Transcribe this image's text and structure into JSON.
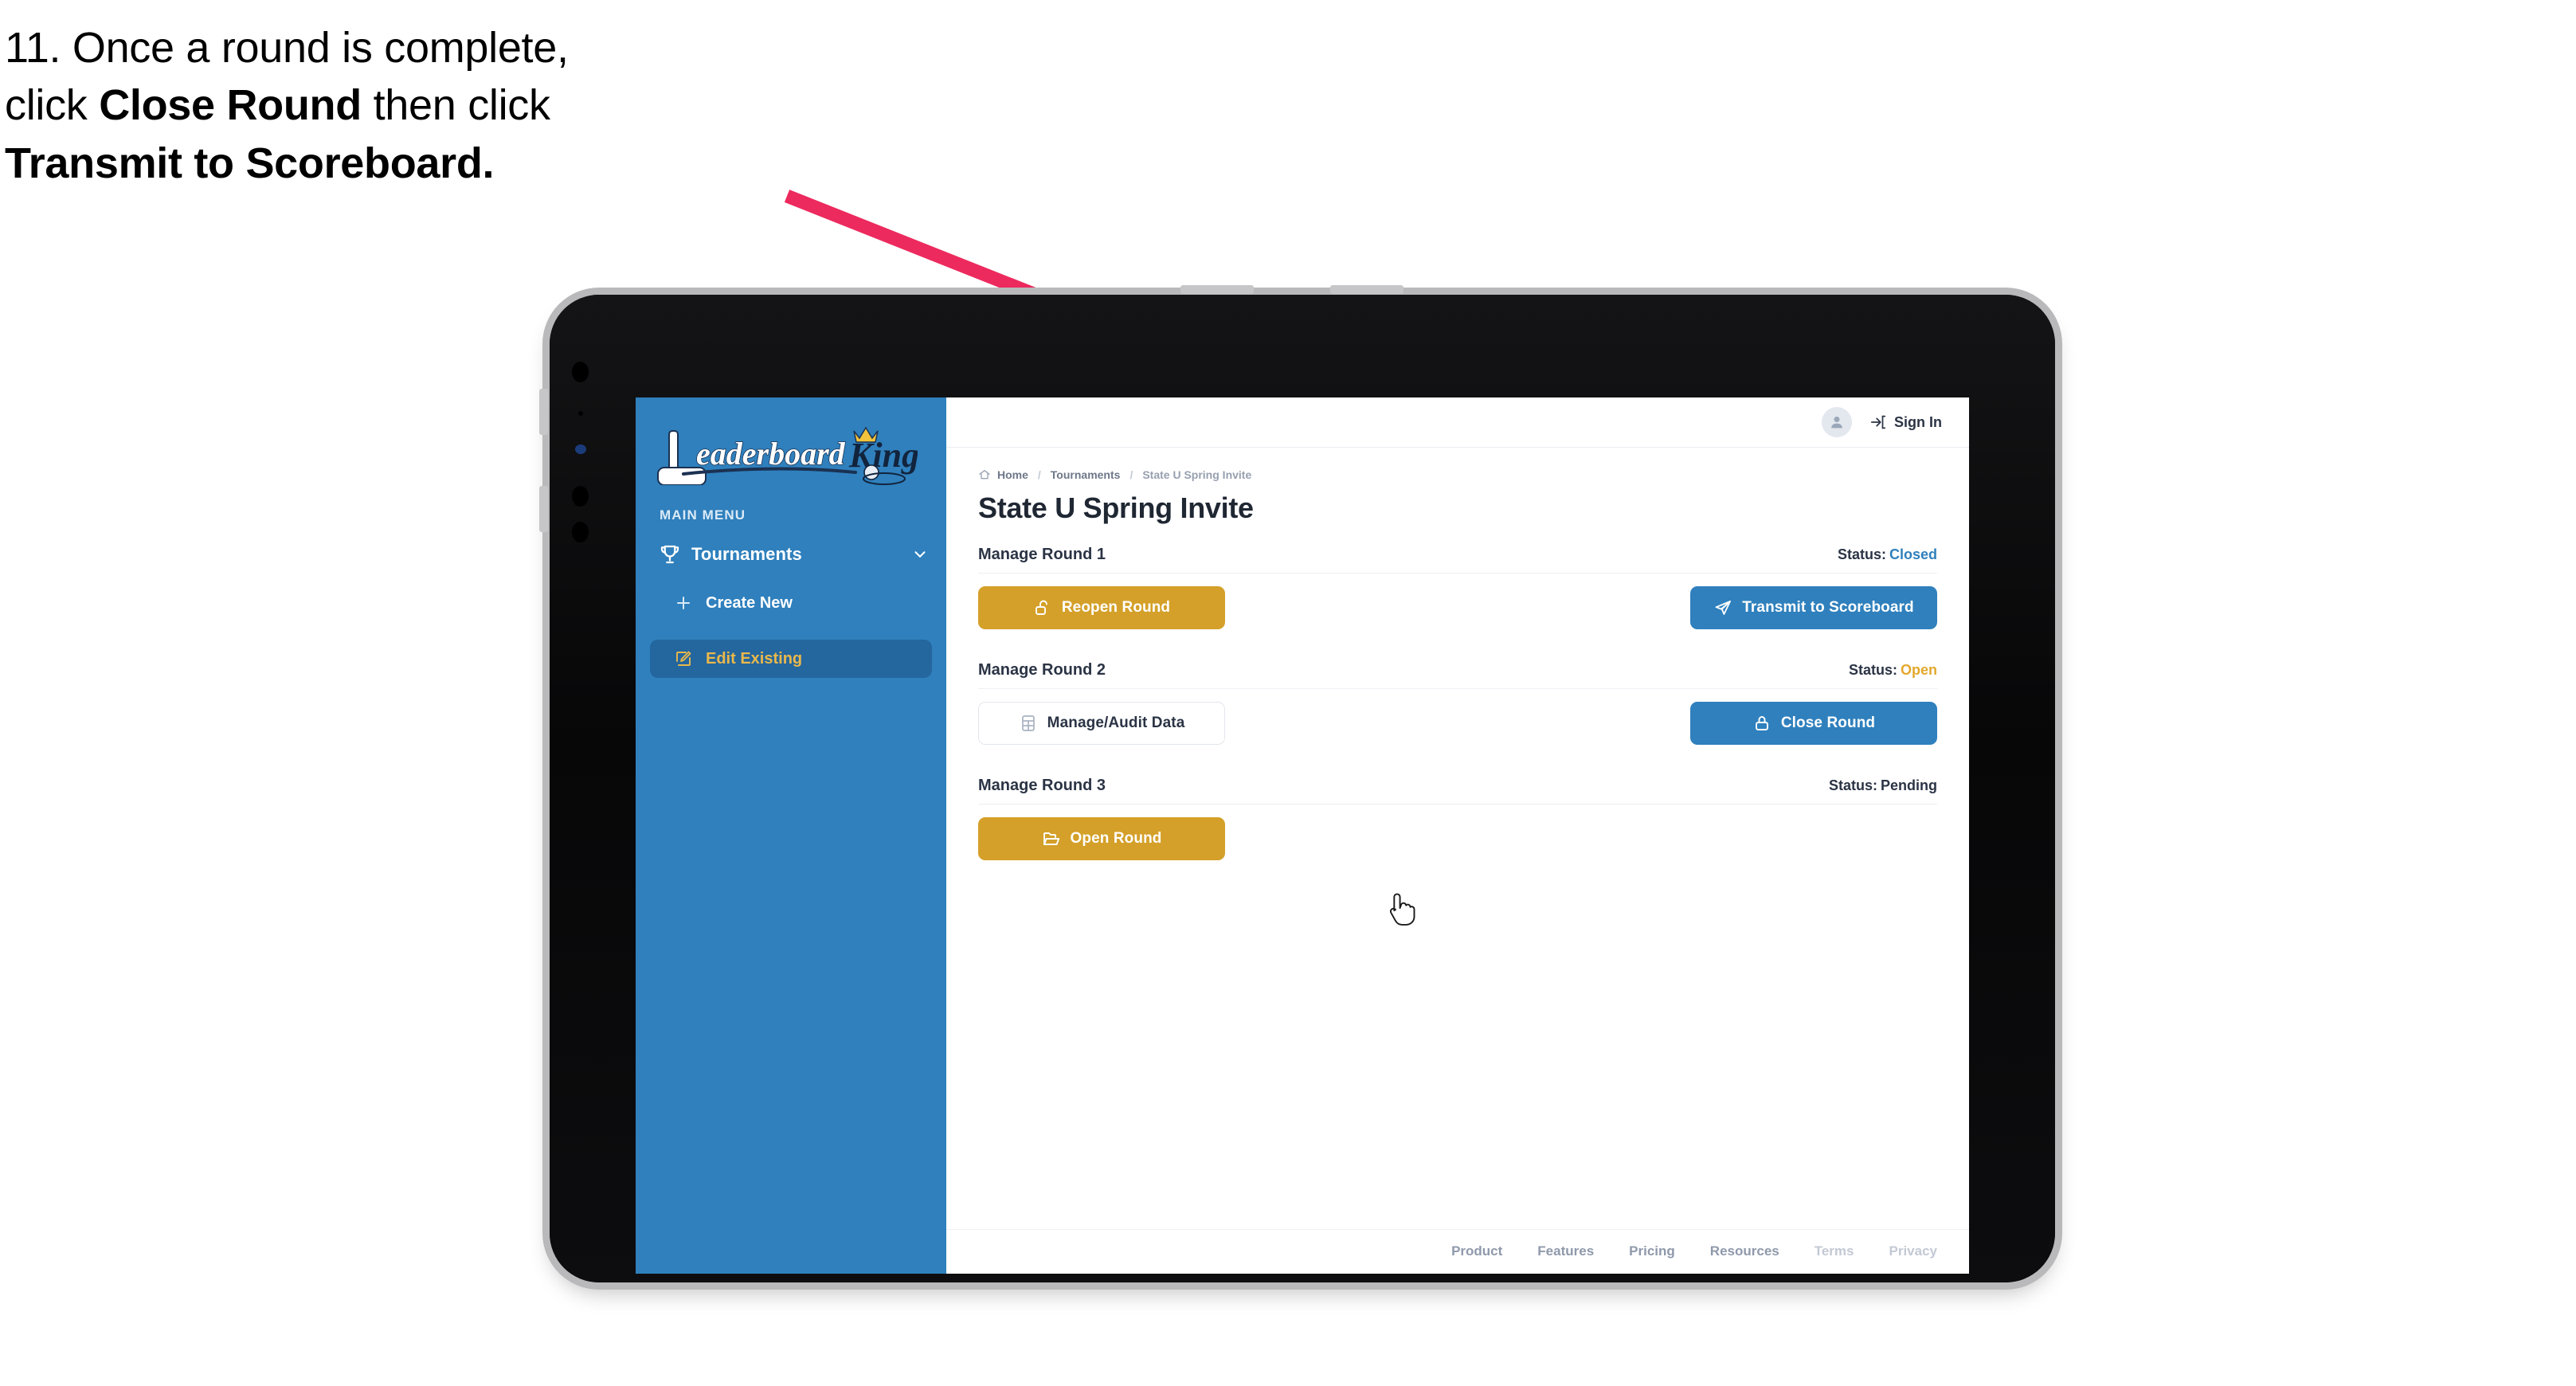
{
  "caption": {
    "line1": "11. Once a round is complete,",
    "line2_pre": "click ",
    "line2_bold": "Close Round",
    "line2_post": " then click",
    "line3_bold": "Transmit to Scoreboard."
  },
  "annotation": {
    "arrow_color": "#ec2a5e",
    "arrow_name": "pointer-arrow"
  },
  "app": {
    "brand": {
      "word_primary": "Leaderboard",
      "word_secondary": "King",
      "icon": "golf-putter-icon"
    },
    "sidebar": {
      "section_label": "MAIN MENU",
      "bg_color": "#2f80bd",
      "active_bg_color": "#24669e",
      "active_text_color": "#e9b84b",
      "items": [
        {
          "label": "Tournaments",
          "icon": "trophy-icon",
          "expander": "chevron-down-icon",
          "active": false
        },
        {
          "label": "Create New",
          "icon": "plus-icon",
          "active": false
        },
        {
          "label": "Edit Existing",
          "icon": "pencil-square-icon",
          "active": true
        }
      ]
    },
    "topbar": {
      "avatar_icon": "user-avatar-icon",
      "signin_icon": "sign-in-arrow-icon",
      "signin_label": "Sign In"
    },
    "breadcrumb": {
      "home_icon": "home-icon",
      "items": [
        "Home",
        "Tournaments",
        "State U Spring Invite"
      ],
      "separator": "/"
    },
    "page_title": "State U Spring Invite",
    "status_label": "Status:",
    "rounds": [
      {
        "title": "Manage Round 1",
        "status_value": "Closed",
        "status_class": "closed",
        "left_button": {
          "label": "Reopen Round",
          "icon": "unlock-icon",
          "style": "gold"
        },
        "right_button": {
          "label": "Transmit to Scoreboard",
          "icon": "paper-plane-icon",
          "style": "blue"
        }
      },
      {
        "title": "Manage Round 2",
        "status_value": "Open",
        "status_class": "open",
        "left_button": {
          "label": "Manage/Audit Data",
          "icon": "table-grid-icon",
          "style": "ghost"
        },
        "right_button": {
          "label": "Close Round",
          "icon": "lock-icon",
          "style": "blue"
        }
      },
      {
        "title": "Manage Round 3",
        "status_value": "Pending",
        "status_class": "pending",
        "left_button": {
          "label": "Open Round",
          "icon": "open-folder-icon",
          "style": "gold"
        },
        "right_button": null
      }
    ],
    "footer_links": [
      {
        "label": "Product",
        "dim": false
      },
      {
        "label": "Features",
        "dim": false
      },
      {
        "label": "Pricing",
        "dim": false
      },
      {
        "label": "Resources",
        "dim": false
      },
      {
        "label": "Terms",
        "dim": true
      },
      {
        "label": "Privacy",
        "dim": true
      }
    ]
  },
  "colors": {
    "brand_blue": "#2f80bd",
    "gold": "#d4a029",
    "status_open": "#e3a82c",
    "text_dark": "#2b3445"
  }
}
